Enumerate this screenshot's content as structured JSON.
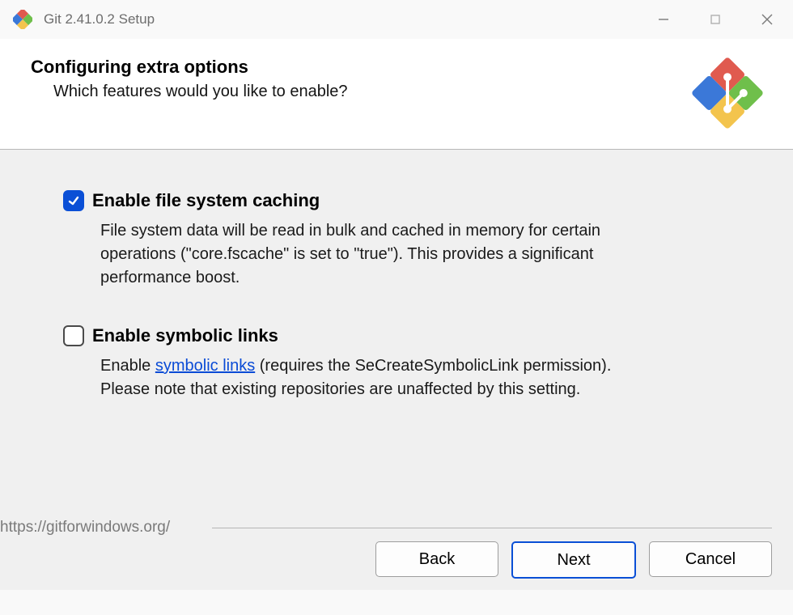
{
  "window": {
    "title": "Git 2.41.0.2 Setup"
  },
  "header": {
    "heading": "Configuring extra options",
    "sub": "Which features would you like to enable?"
  },
  "options": {
    "fscache": {
      "checked": true,
      "label": "Enable file system caching",
      "desc": "File system data will be read in bulk and cached in memory for certain operations (\"core.fscache\" is set to \"true\"). This provides a significant performance boost."
    },
    "symlinks": {
      "checked": false,
      "label": "Enable symbolic links",
      "desc_pre": "Enable ",
      "desc_link": "symbolic links",
      "desc_post": " (requires the SeCreateSymbolicLink permission). Please note that existing repositories are unaffected by this setting."
    }
  },
  "footer": {
    "url": "https://gitforwindows.org/",
    "back": "Back",
    "next": "Next",
    "cancel": "Cancel"
  }
}
